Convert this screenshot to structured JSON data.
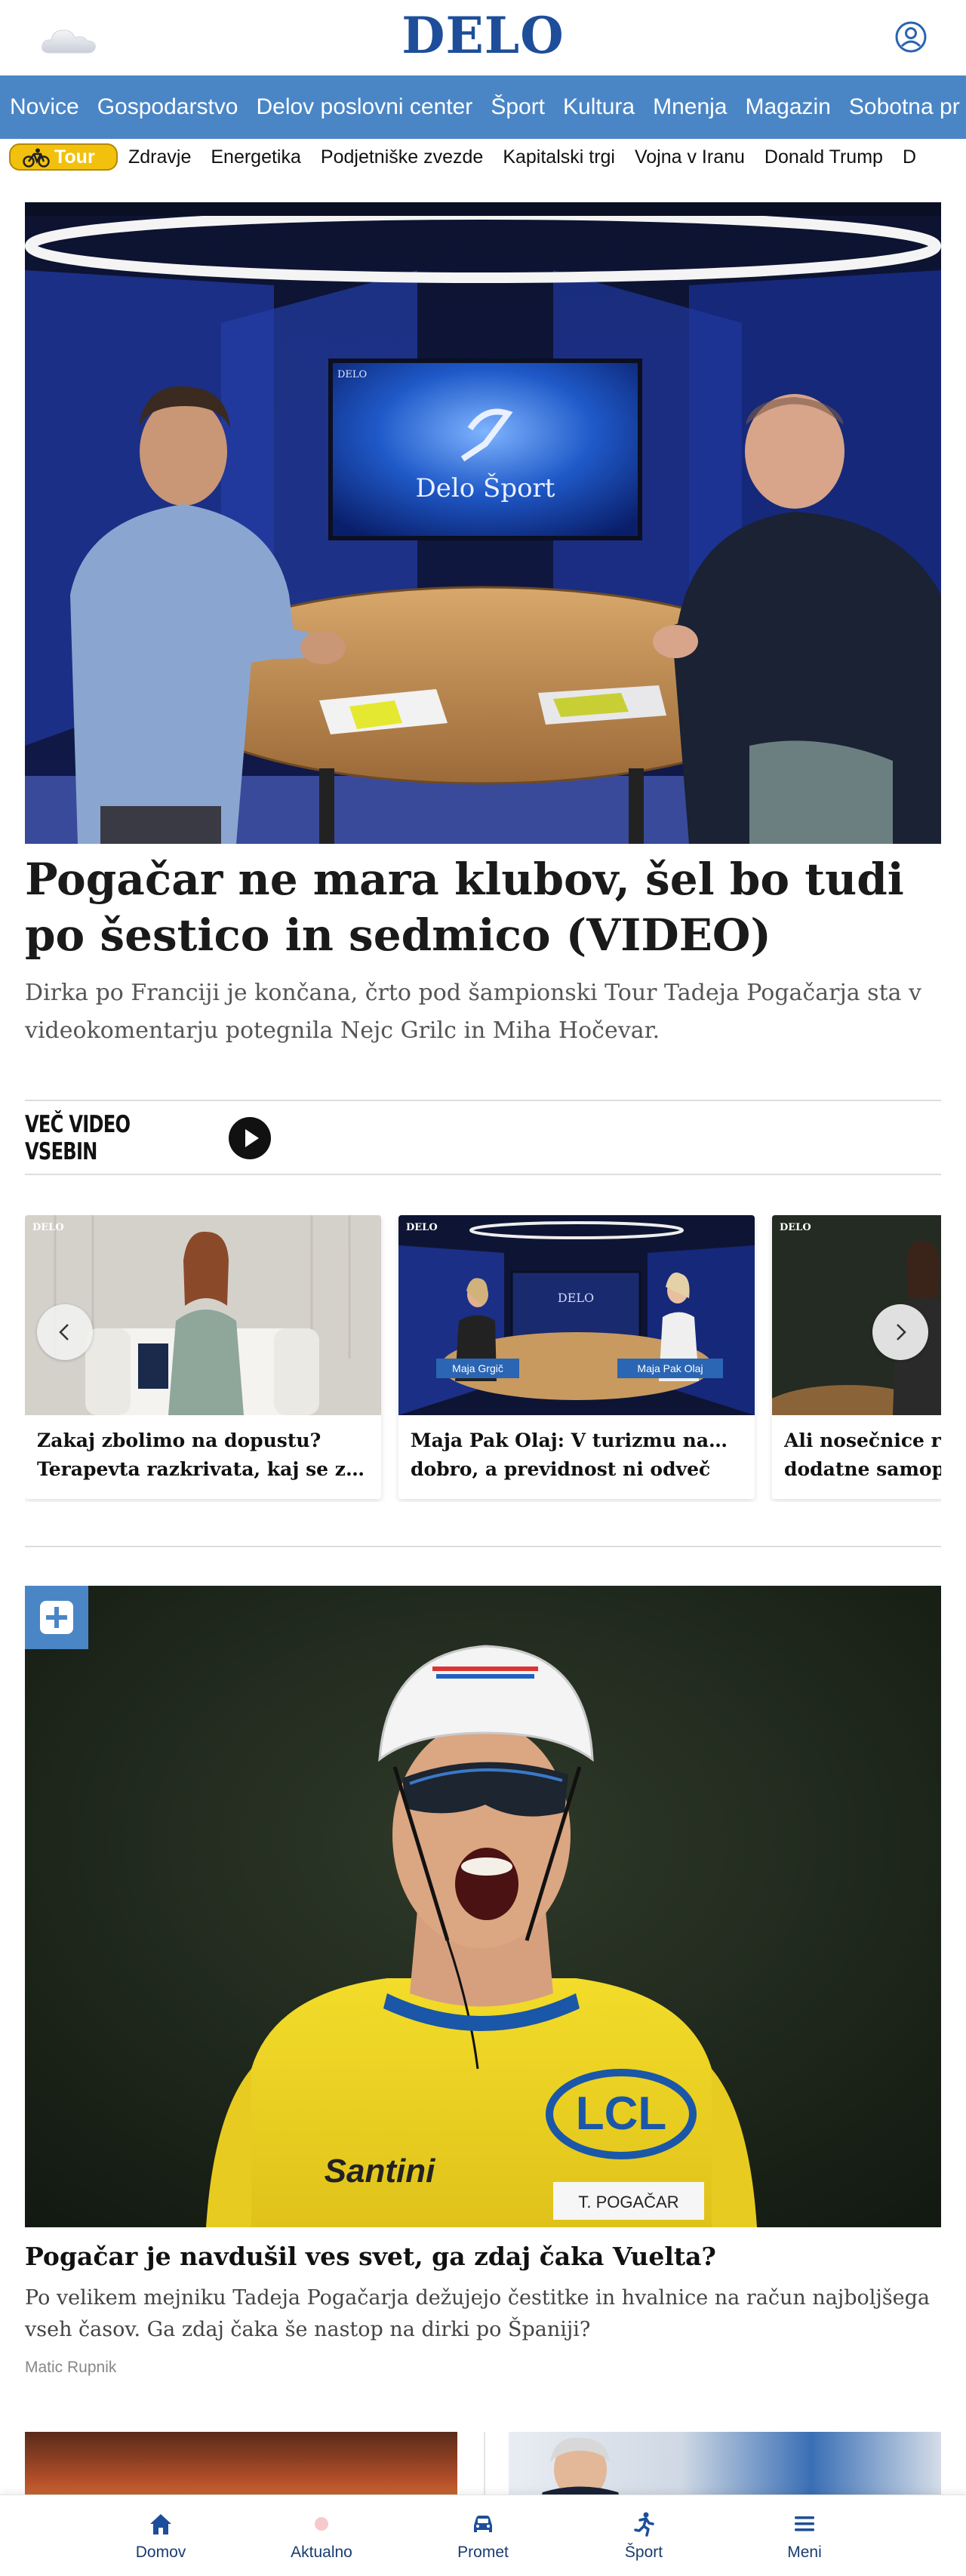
{
  "header": {
    "logo": "DELO",
    "weather_icon": "cloud-icon",
    "account_icon": "user-circle-icon"
  },
  "main_nav": [
    "Novice",
    "Gospodarstvo",
    "Delov poslovni center",
    "Šport",
    "Kultura",
    "Mnenja",
    "Magazin",
    "Sobotna pr"
  ],
  "tag_bar": {
    "featured": "Tour",
    "featured_icon": "bicycle-icon",
    "items": [
      "Zdravje",
      "Energetika",
      "Podjetniške zvezde",
      "Kapitalski trgi",
      "Vojna v Iranu",
      "Donald Trump",
      "D"
    ]
  },
  "hero": {
    "title": "Pogačar ne mara klubov, šel bo tudi po šestico in sedmico (VIDEO)",
    "lead": "Dirka po Franciji je končana, črto pod šampionski Tour Tadeja Pogačarja sta v videokomentarju potegnila Nejc Grilc in Miha Hočevar.",
    "screen_brand": "Delo Šport",
    "corner_logo": "DELO"
  },
  "video_section": {
    "label": "VEČ VIDEO VSEBIN",
    "cards": [
      {
        "title_line1": "Zakaj zbolimo na dopustu?",
        "title_line2": "Terapevta razkrivata, kaj se zgo...",
        "corner_logo": "DELO"
      },
      {
        "title_line1": "Maja Pak Olaj: V turizmu nam gre",
        "title_line2": "dobro, a previdnost ni odveč",
        "corner_logo": "DELO",
        "name_left": "Maja Grgič",
        "name_right": "Maja Pak Olaj",
        "screen_logo": "DELO"
      },
      {
        "title_line1": "Ali nosečnice res",
        "title_line2": "dodatne samopla",
        "corner_logo": "DELO"
      }
    ]
  },
  "article2": {
    "badge_icon": "plus-icon",
    "title": "Pogačar je navdušil ves svet, ga zdaj čaka Vuelta?",
    "lead": "Po velikem mejniku Tadeja Pogačarja dežujejo čestitke in hvalnice na račun najboljšega vseh časov. Ga zdaj čaka še nastop na dirki po Španiji?",
    "author": "Matic Rupnik",
    "jersey_text": "LCL",
    "jersey_brand": "Santini",
    "bib_name": "T. POGAČAR"
  },
  "bottom_nav": [
    {
      "label": "Domov",
      "icon": "home-icon"
    },
    {
      "label": "Aktualno",
      "icon": "live-dot-icon"
    },
    {
      "label": "Promet",
      "icon": "car-icon"
    },
    {
      "label": "Šport",
      "icon": "runner-icon"
    },
    {
      "label": "Meni",
      "icon": "menu-icon"
    }
  ],
  "colors": {
    "brand": "#1e4e9a",
    "nav_bg": "#4a86c6",
    "tour_yellow": "#f2c10d"
  }
}
